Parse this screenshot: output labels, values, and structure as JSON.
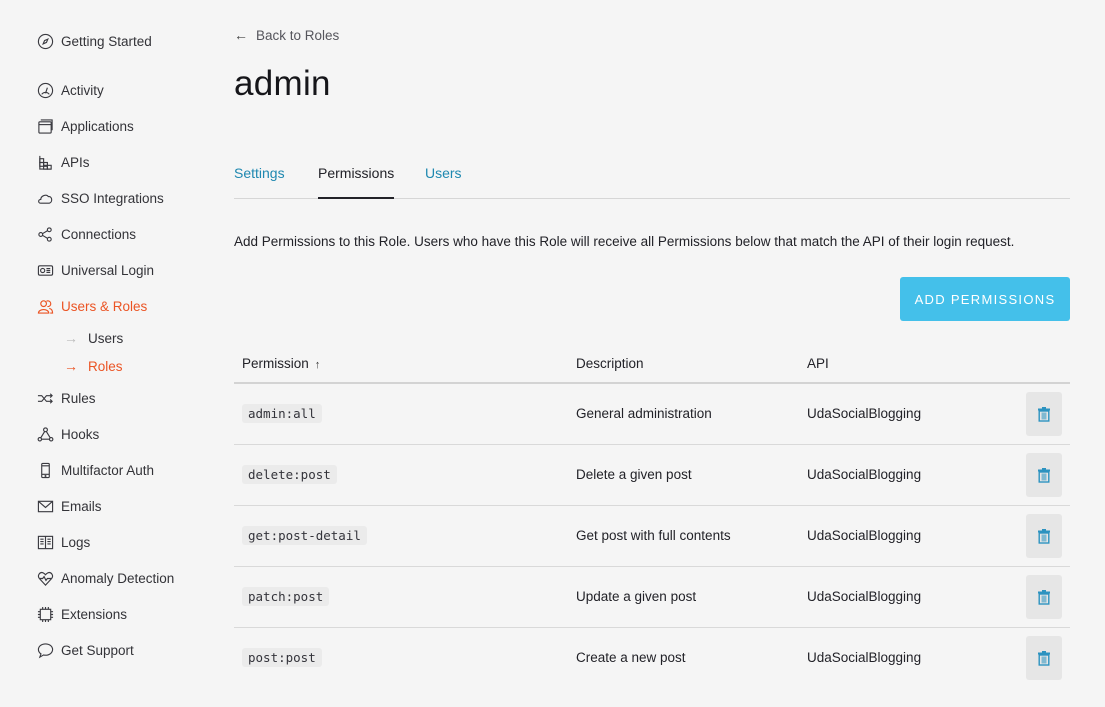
{
  "sidebar": {
    "items": [
      {
        "label": "Getting Started",
        "icon": "compass-icon"
      },
      {
        "label": "Activity",
        "icon": "gauge-icon"
      },
      {
        "label": "Applications",
        "icon": "window-stack-icon"
      },
      {
        "label": "APIs",
        "icon": "blocks-icon"
      },
      {
        "label": "SSO Integrations",
        "icon": "cloud-icon"
      },
      {
        "label": "Connections",
        "icon": "share-nodes-icon"
      },
      {
        "label": "Universal Login",
        "icon": "id-card-icon"
      },
      {
        "label": "Users & Roles",
        "icon": "users-icon",
        "active": true
      },
      {
        "label": "Rules",
        "icon": "shuffle-icon"
      },
      {
        "label": "Hooks",
        "icon": "hooks-icon"
      },
      {
        "label": "Multifactor Auth",
        "icon": "phone-icon"
      },
      {
        "label": "Emails",
        "icon": "envelope-icon"
      },
      {
        "label": "Logs",
        "icon": "book-icon"
      },
      {
        "label": "Anomaly Detection",
        "icon": "heart-pulse-icon"
      },
      {
        "label": "Extensions",
        "icon": "chip-icon"
      },
      {
        "label": "Get Support",
        "icon": "chat-bubble-icon"
      }
    ],
    "sub_items": [
      {
        "label": "Users",
        "active": false
      },
      {
        "label": "Roles",
        "active": true
      }
    ]
  },
  "header": {
    "back_label": "Back to Roles",
    "title": "admin"
  },
  "tabs": [
    {
      "label": "Settings",
      "active": false
    },
    {
      "label": "Permissions",
      "active": true
    },
    {
      "label": "Users",
      "active": false
    }
  ],
  "description": "Add Permissions to this Role. Users who have this Role will receive all Permissions below that match the API of their login request.",
  "add_button_label": "ADD PERMISSIONS",
  "table": {
    "columns": [
      "Permission",
      "Description",
      "API"
    ],
    "sort_indicator": "↑",
    "rows": [
      {
        "permission": "admin:all",
        "description": "General administration",
        "api": "UdaSocialBlogging"
      },
      {
        "permission": "delete:post",
        "description": "Delete a given post",
        "api": "UdaSocialBlogging"
      },
      {
        "permission": "get:post-detail",
        "description": "Get post with full contents",
        "api": "UdaSocialBlogging"
      },
      {
        "permission": "patch:post",
        "description": "Update a given post",
        "api": "UdaSocialBlogging"
      },
      {
        "permission": "post:post",
        "description": "Create a new post",
        "api": "UdaSocialBlogging"
      }
    ]
  },
  "colors": {
    "accent": "#eb5424",
    "link": "#1e88b0",
    "primary_button": "#44c0ea",
    "delete_icon": "#2c93c0"
  }
}
